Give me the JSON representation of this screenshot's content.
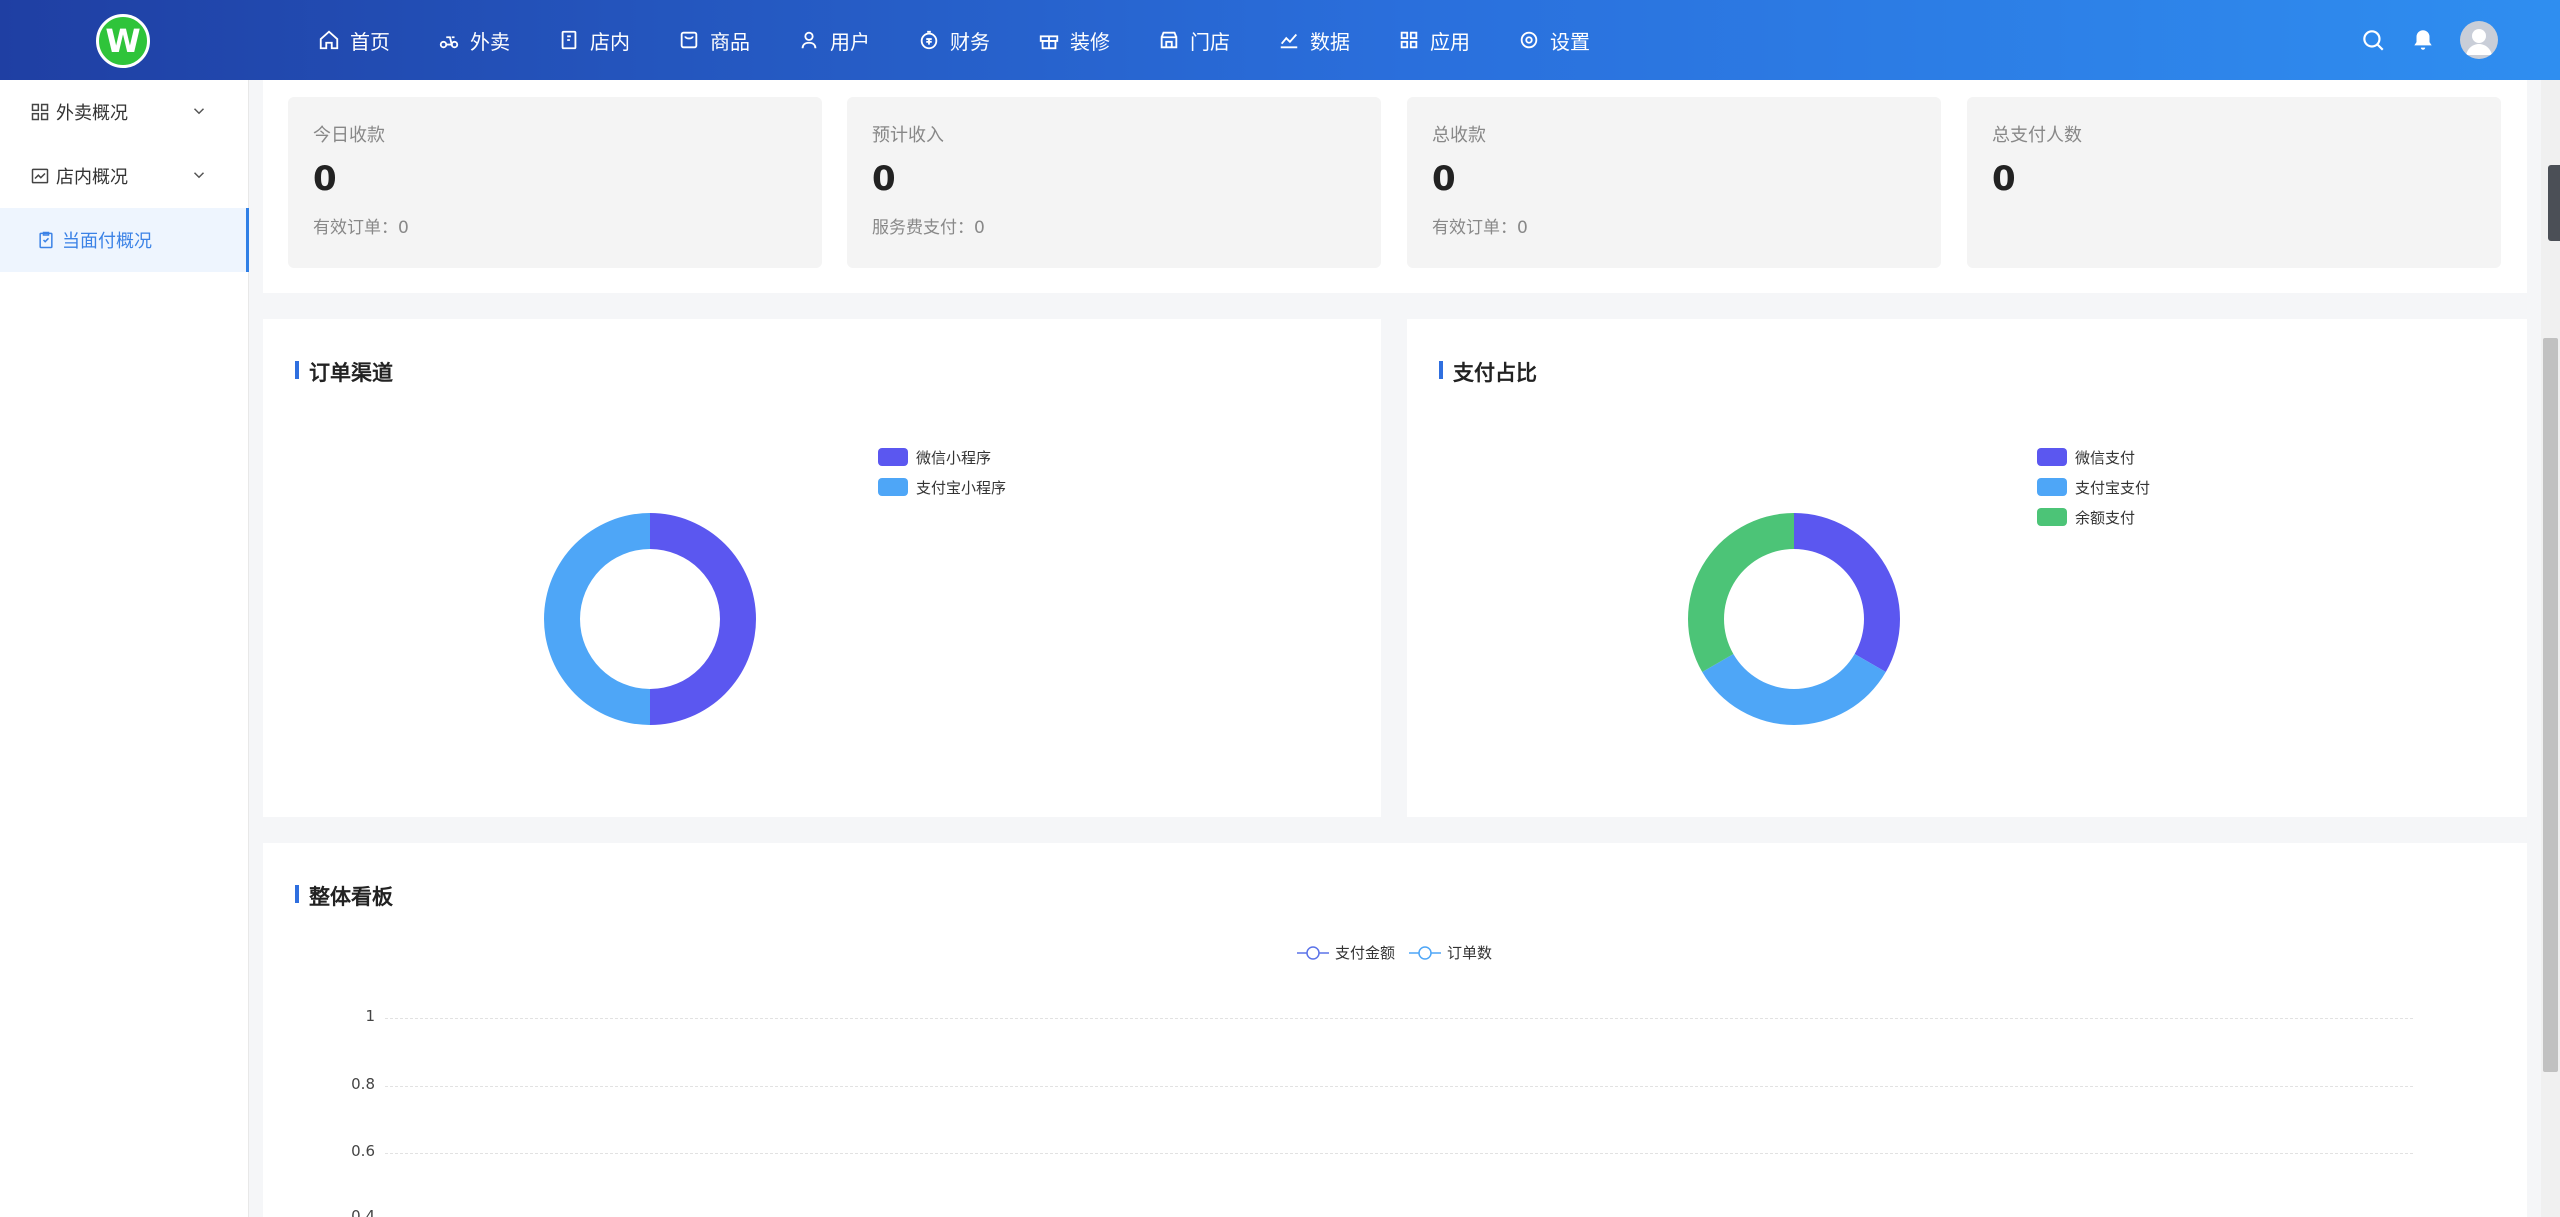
{
  "header": {
    "logo_letter": "W",
    "nav": [
      {
        "label": "首页",
        "icon": "home-icon"
      },
      {
        "label": "外卖",
        "icon": "scooter-icon"
      },
      {
        "label": "店内",
        "icon": "document-icon"
      },
      {
        "label": "商品",
        "icon": "box-icon"
      },
      {
        "label": "用户",
        "icon": "user-icon"
      },
      {
        "label": "财务",
        "icon": "money-icon"
      },
      {
        "label": "装修",
        "icon": "gift-icon"
      },
      {
        "label": "门店",
        "icon": "store-icon"
      },
      {
        "label": "数据",
        "icon": "line-chart-icon"
      },
      {
        "label": "应用",
        "icon": "grid-icon"
      },
      {
        "label": "设置",
        "icon": "gear-icon"
      }
    ]
  },
  "sidebar": {
    "items": [
      {
        "label": "外卖概况",
        "icon": "grid-icon",
        "expandable": true
      },
      {
        "label": "店内概况",
        "icon": "chart-icon",
        "expandable": true
      },
      {
        "label": "当面付概况",
        "icon": "clipboard-icon",
        "active": true
      }
    ]
  },
  "stats": [
    {
      "label": "今日收款",
      "value": "0",
      "sub": "有效订单：0"
    },
    {
      "label": "预计收入",
      "value": "0",
      "sub": "服务费支付：0"
    },
    {
      "label": "总收款",
      "value": "0",
      "sub": "有效订单：0"
    },
    {
      "label": "总支付人数",
      "value": "0",
      "sub": ""
    }
  ],
  "colors": {
    "purple": "#5b57f0",
    "blue": "#4ea6f7",
    "green": "#4cc477",
    "accent": "#2f6fdf"
  },
  "panels": {
    "order_channel_title": "订单渠道",
    "payment_ratio_title": "支付占比",
    "overall_title": "整体看板"
  },
  "chart_data": [
    {
      "type": "pie",
      "title": "订单渠道",
      "categories": [
        "微信小程序",
        "支付宝小程序"
      ],
      "values": [
        50,
        50
      ],
      "colors": [
        "#5b57f0",
        "#4ea6f7"
      ],
      "legend": "top-right"
    },
    {
      "type": "pie",
      "title": "支付占比",
      "categories": [
        "微信支付",
        "支付宝支付",
        "余额支付"
      ],
      "values": [
        33.3,
        33.3,
        33.3
      ],
      "colors": [
        "#5b57f0",
        "#4ea6f7",
        "#4cc477"
      ],
      "legend": "top-right"
    },
    {
      "type": "line",
      "title": "整体看板",
      "series": [
        {
          "name": "支付金额",
          "values": []
        },
        {
          "name": "订单数",
          "values": []
        }
      ],
      "yticks": [
        "1",
        "0.8",
        "0.6",
        "0.4"
      ],
      "grid": true,
      "legend": "top-center"
    }
  ]
}
